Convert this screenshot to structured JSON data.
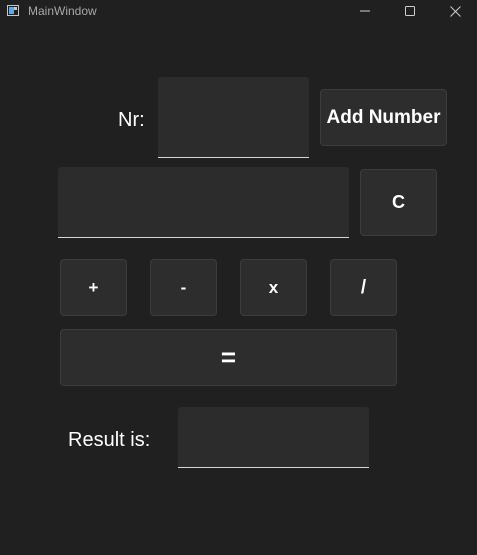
{
  "window": {
    "title": "MainWindow",
    "minimize_icon": "minimize-icon",
    "maximize_icon": "maximize-icon",
    "close_icon": "close-icon"
  },
  "number_entry": {
    "label": "Nr:",
    "value": "",
    "add_label": "Add Number"
  },
  "expression": {
    "value": "",
    "clear_label": "C"
  },
  "operators": {
    "plus": "+",
    "minus": "-",
    "multiply": "x",
    "divide": "/"
  },
  "equals_label": "=",
  "result": {
    "label": "Result is:",
    "value": ""
  },
  "colors": {
    "background": "#202020",
    "surface": "#2d2d2d",
    "text": "#ffffff"
  }
}
